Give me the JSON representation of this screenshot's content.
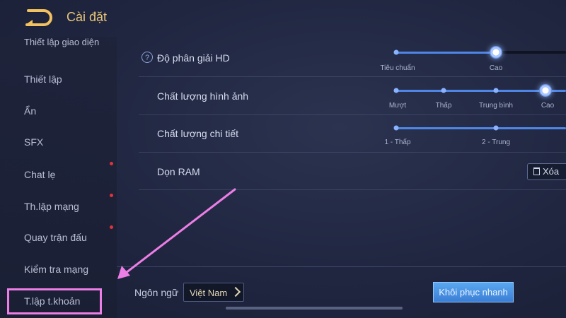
{
  "header": {
    "title": "Cài đặt",
    "back_icon": "back-arrow-icon"
  },
  "sidebar": {
    "items": [
      {
        "label": "Thiết lập giao diện"
      },
      {
        "label": "Thiết lập"
      },
      {
        "label": "Ẩn"
      },
      {
        "label": "SFX"
      },
      {
        "label": "Chat lẹ"
      },
      {
        "label": "Th.lập mạng"
      },
      {
        "label": "Quay trận đấu"
      },
      {
        "label": "Kiểm tra mạng"
      },
      {
        "label": "T.lập t.khoản"
      }
    ]
  },
  "settings": {
    "resolution": {
      "label": "Độ phân giải HD",
      "options": [
        "Tiêu chuẩn",
        "Cao"
      ],
      "selected": "Cao"
    },
    "image_quality": {
      "label": "Chất lượng hình ảnh",
      "options": [
        "Mượt",
        "Thấp",
        "Trung bình",
        "Cao"
      ],
      "selected": "Cao"
    },
    "detail_quality": {
      "label": "Chất lượng chi tiết",
      "options": [
        "1 - Thấp",
        "2 - Trung"
      ]
    },
    "ram": {
      "label": "Dọn RAM",
      "button": "Xóa"
    }
  },
  "footer": {
    "language_label": "Ngôn ngữ",
    "language_value": "Việt Nam",
    "restore_button": "Khôi phục nhanh"
  },
  "colors": {
    "accent": "#4f86e6",
    "title": "#e9c67a",
    "highlight": "#ec7ee6",
    "badge": "#e0323a"
  }
}
